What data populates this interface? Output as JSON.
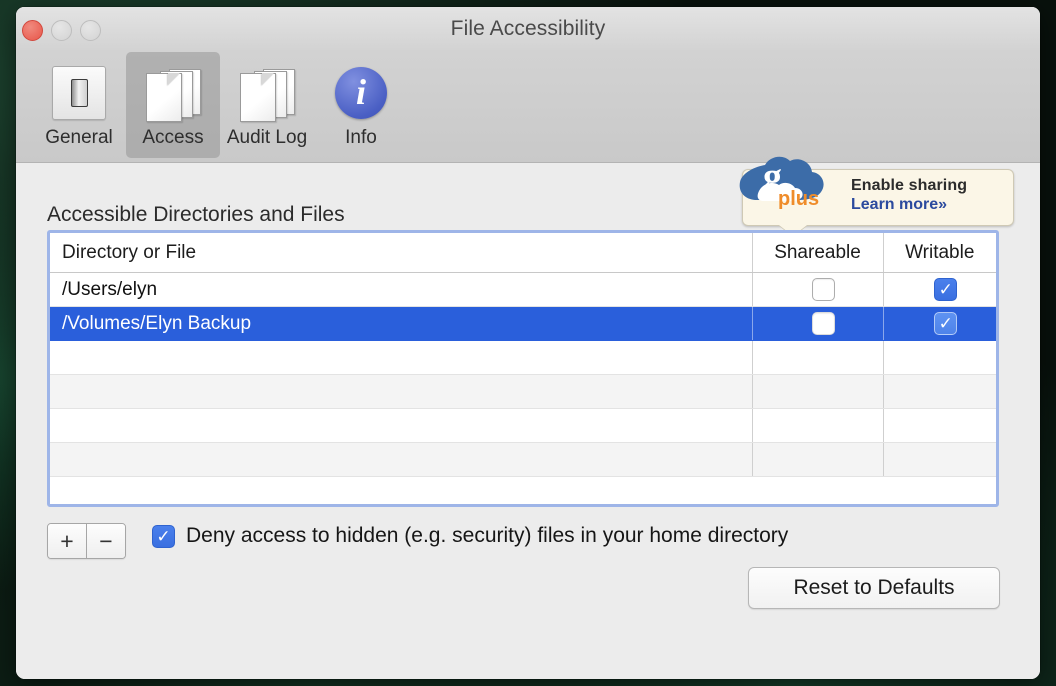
{
  "window": {
    "title": "File Accessibility",
    "traffic_lights": [
      "close-button",
      "minimize-button",
      "zoom-button"
    ]
  },
  "toolbar": {
    "items": [
      {
        "label": "General",
        "icon": "switch-icon",
        "selected": false
      },
      {
        "label": "Access",
        "icon": "documents-icon",
        "selected": true
      },
      {
        "label": "Audit Log",
        "icon": "documents-icon",
        "selected": false
      },
      {
        "label": "Info",
        "icon": "info-icon",
        "selected": false
      }
    ]
  },
  "main": {
    "section_label": "Accessible Directories and Files",
    "promo": {
      "logo_g": "g",
      "logo_plus": "plus",
      "line1": "Enable sharing",
      "line2": "Learn more»"
    },
    "table": {
      "columns": [
        "Directory or File",
        "Shareable",
        "Writable"
      ],
      "rows": [
        {
          "path": "/Users/elyn",
          "shareable": false,
          "writable": true,
          "selected": false
        },
        {
          "path": "/Volumes/Elyn Backup",
          "shareable": false,
          "writable": true,
          "selected": true
        },
        {
          "path": "",
          "shareable": null,
          "writable": null,
          "selected": false
        },
        {
          "path": "",
          "shareable": null,
          "writable": null,
          "selected": false
        },
        {
          "path": "",
          "shareable": null,
          "writable": null,
          "selected": false
        },
        {
          "path": "",
          "shareable": null,
          "writable": null,
          "selected": false
        }
      ]
    },
    "add_label": "+",
    "remove_label": "−",
    "deny_checkbox": {
      "checked": true,
      "label": "Deny access to hidden (e.g. security) files in your home directory"
    },
    "reset_button": "Reset to Defaults",
    "checkmark": "✓"
  },
  "colors": {
    "selection_blue": "#2a5fdb",
    "checkbox_blue": "#3a6fe0",
    "close_red": "#e8564a",
    "info_blue": "#4a5fc4",
    "promo_bg": "#fbf6e7",
    "link_blue": "#2b4a9e",
    "plus_orange": "#ef8c2a"
  }
}
